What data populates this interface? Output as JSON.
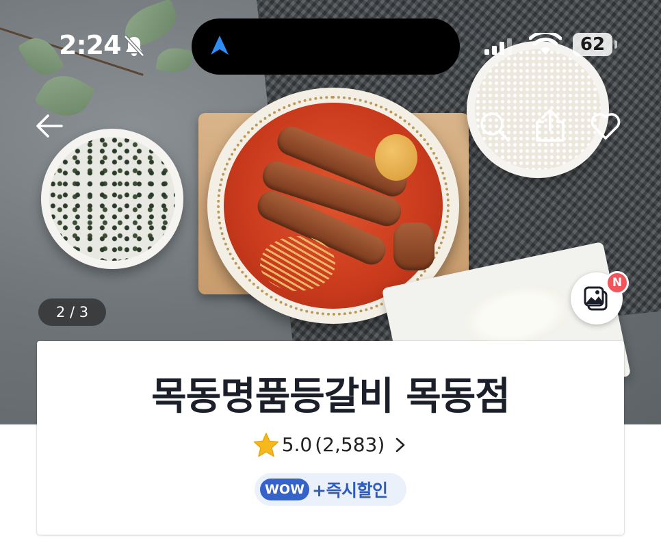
{
  "status_bar": {
    "time": "2:24",
    "battery_level": "62",
    "icons": [
      "bell-off-icon",
      "navigation-arrow-icon",
      "cellular-signal-icon",
      "wifi-icon",
      "battery-icon"
    ]
  },
  "header": {
    "icons": [
      "back-arrow-icon",
      "search-icon",
      "share-icon",
      "heart-icon"
    ]
  },
  "gallery": {
    "counter": "2 / 3",
    "photo_review_badge": "N"
  },
  "store": {
    "name": "목동명품등갈비 목동점",
    "rating": "5.0",
    "review_count": "(2,583)",
    "wow_label": "WOW",
    "discount_label": "+즉시할인"
  },
  "colors": {
    "accent_blue": "#3563c9",
    "pill_background": "#eaf1fb",
    "badge_red": "#f2545b",
    "star_yellow": "#f6b81c"
  }
}
